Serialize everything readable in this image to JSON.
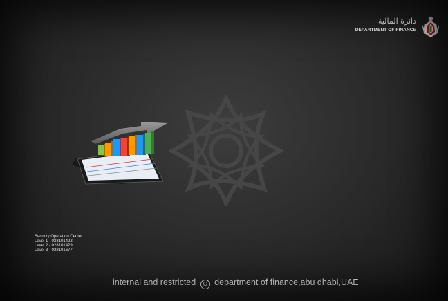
{
  "logo": {
    "arabic_text": "دائرة المالية",
    "english_text": "DEPARTMENT OF FINANCE",
    "emblem_icon": "falcon-emblem-icon"
  },
  "illustration": {
    "icon": "bar-chart-growth-icon",
    "watermark_icon": "eight-point-star-icon"
  },
  "security": {
    "title": "Security Operation Center",
    "levels": [
      "Level 1 - 028101422",
      "Level 2 - 028101429",
      "Level 3 - 028101677"
    ]
  },
  "footer": {
    "prefix": "internal and restricted",
    "copyright_symbol": "C",
    "suffix": "department of finance,abu dhabi,UAE"
  },
  "colors": {
    "background": "#2c2c2c",
    "text": "#f4f4f4"
  }
}
